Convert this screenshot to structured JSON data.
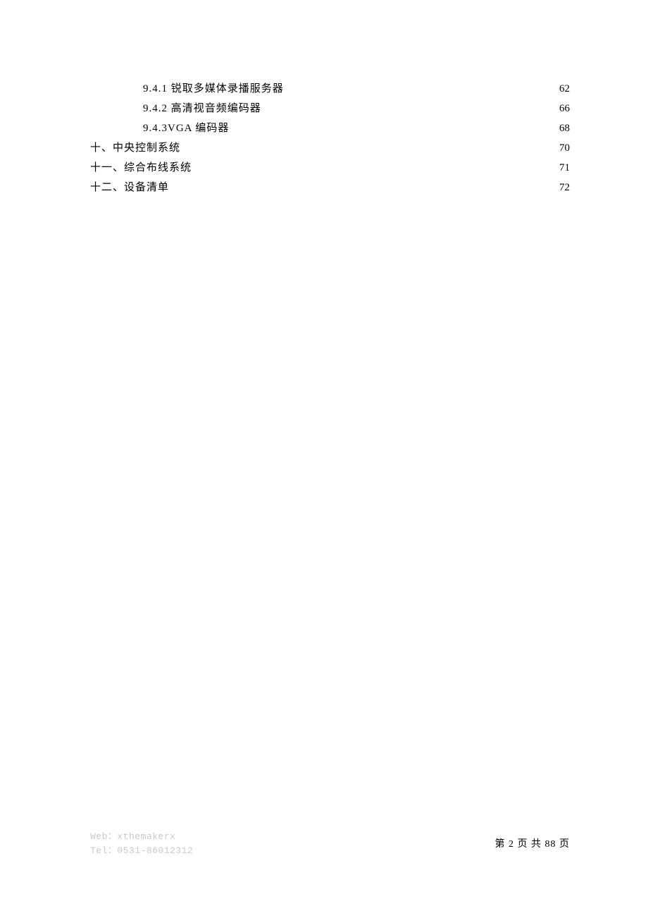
{
  "toc": {
    "items": [
      {
        "label": "9.4.1 锐取多媒体录播服务器",
        "page": "62",
        "indent": 2
      },
      {
        "label": "9.4.2 高清视音频编码器",
        "page": "66",
        "indent": 2
      },
      {
        "label": "9.4.3VGA 编码器",
        "page": "68",
        "indent": 2
      },
      {
        "label": "十、中央控制系统",
        "page": "70",
        "indent": 0
      },
      {
        "label": "十一、综合布线系统",
        "page": "71",
        "indent": 0
      },
      {
        "label": "十二、设备清单",
        "page": "72",
        "indent": 0
      }
    ]
  },
  "footer": {
    "web_label": "Web：",
    "web_value": "xthemakerx",
    "tel_label": "Tel：",
    "tel_value": "0531-86012312",
    "page_prefix": "第 ",
    "page_current": "2",
    "page_mid": " 页 共 ",
    "page_total": "88",
    "page_suffix": " 页"
  }
}
